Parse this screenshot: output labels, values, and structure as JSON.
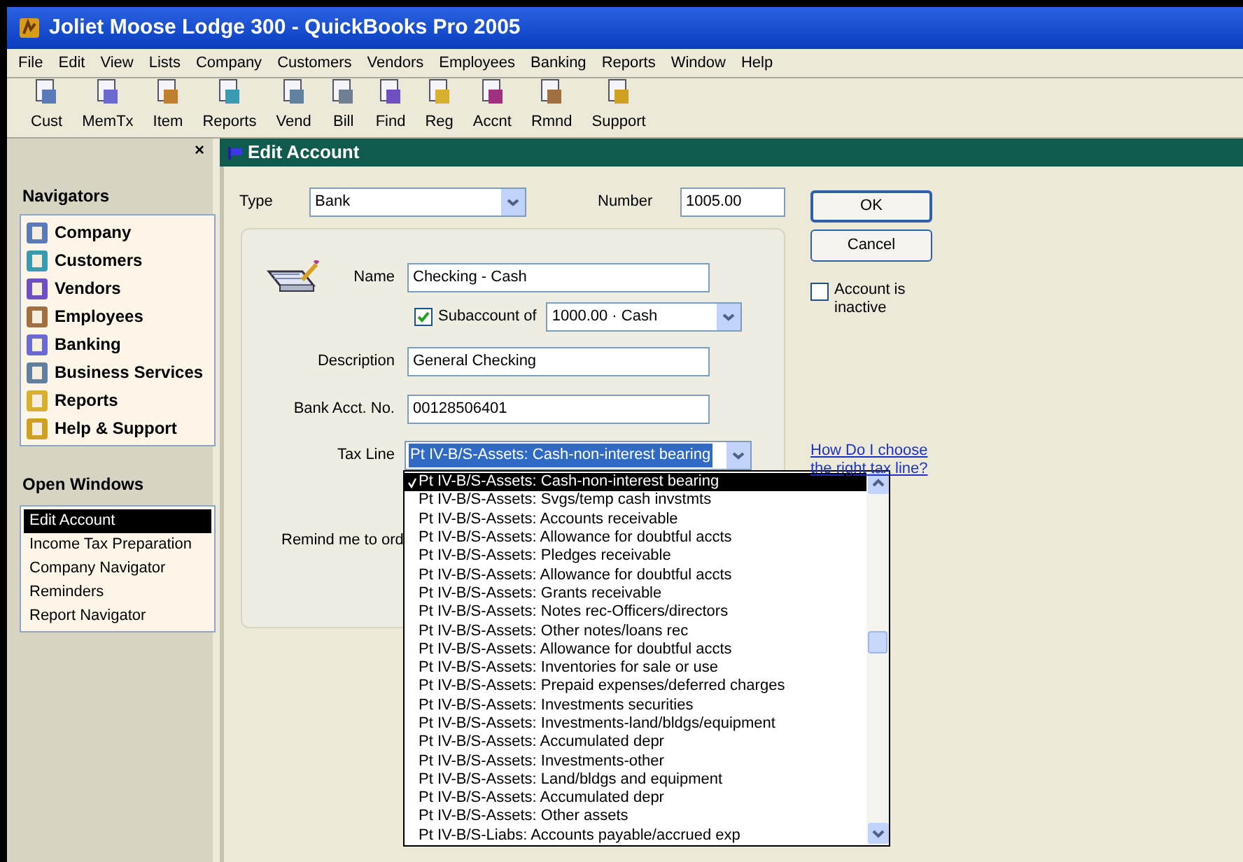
{
  "window": {
    "title": "Joliet Moose Lodge 300 - QuickBooks Pro 2005"
  },
  "menu": [
    "File",
    "Edit",
    "View",
    "Lists",
    "Company",
    "Customers",
    "Vendors",
    "Employees",
    "Banking",
    "Reports",
    "Window",
    "Help"
  ],
  "toolbar": [
    "Cust",
    "MemTx",
    "Item",
    "Reports",
    "Vend",
    "Bill",
    "Find",
    "Reg",
    "Accnt",
    "Rmnd",
    "Support"
  ],
  "sidebar": {
    "close": "×",
    "navigators_title": "Navigators",
    "navigators": [
      "Company",
      "Customers",
      "Vendors",
      "Employees",
      "Banking",
      "Business Services",
      "Reports",
      "Help & Support"
    ],
    "open_windows_title": "Open Windows",
    "open_windows": [
      {
        "label": "Edit Account",
        "selected": true
      },
      {
        "label": "Income Tax Preparation",
        "selected": false
      },
      {
        "label": "Company Navigator",
        "selected": false
      },
      {
        "label": "Reminders",
        "selected": false
      },
      {
        "label": "Report Navigator",
        "selected": false
      }
    ]
  },
  "dialog": {
    "title": "Edit Account",
    "type": {
      "label": "Type",
      "value": "Bank"
    },
    "number": {
      "label": "Number",
      "value": "1005.00"
    },
    "buttons": [
      "OK",
      "Cancel"
    ],
    "inactive": {
      "label": "Account is inactive",
      "checked": false
    },
    "name": {
      "label": "Name",
      "value": "Checking - Cash"
    },
    "subaccount": {
      "label": "Subaccount of",
      "checked": true,
      "value": "1000.00 · Cash"
    },
    "description": {
      "label": "Description",
      "value": "General Checking"
    },
    "bank_acct": {
      "label": "Bank Acct. No.",
      "value": "00128506401"
    },
    "tax_line": {
      "label": "Tax Line",
      "value": "Pt IV-B/S-Assets: Cash-non-interest bearing"
    },
    "help_link": "How Do I choose the right tax line?",
    "remind": "Remind me to ord",
    "tax_line_options": [
      {
        "label": "Pt IV-B/S-Assets: Cash-non-interest bearing",
        "selected": true
      },
      {
        "label": "Pt IV-B/S-Assets: Svgs/temp cash invstmts",
        "selected": false
      },
      {
        "label": "Pt IV-B/S-Assets: Accounts receivable",
        "selected": false
      },
      {
        "label": "Pt IV-B/S-Assets: Allowance for doubtful accts",
        "selected": false
      },
      {
        "label": "Pt IV-B/S-Assets: Pledges receivable",
        "selected": false
      },
      {
        "label": "Pt IV-B/S-Assets: Allowance for doubtful accts",
        "selected": false
      },
      {
        "label": "Pt IV-B/S-Assets: Grants receivable",
        "selected": false
      },
      {
        "label": "Pt IV-B/S-Assets: Notes rec-Officers/directors",
        "selected": false
      },
      {
        "label": "Pt IV-B/S-Assets: Other notes/loans rec",
        "selected": false
      },
      {
        "label": "Pt IV-B/S-Assets: Allowance for doubtful accts",
        "selected": false
      },
      {
        "label": "Pt IV-B/S-Assets: Inventories for sale or use",
        "selected": false
      },
      {
        "label": "Pt IV-B/S-Assets: Prepaid expenses/deferred charges",
        "selected": false
      },
      {
        "label": "Pt IV-B/S-Assets: Investments securities",
        "selected": false
      },
      {
        "label": "Pt IV-B/S-Assets: Investments-land/bldgs/equipment",
        "selected": false
      },
      {
        "label": "Pt IV-B/S-Assets: Accumulated depr",
        "selected": false
      },
      {
        "label": "Pt IV-B/S-Assets: Investments-other",
        "selected": false
      },
      {
        "label": "Pt IV-B/S-Assets: Land/bldgs and equipment",
        "selected": false
      },
      {
        "label": "Pt IV-B/S-Assets: Accumulated depr",
        "selected": false
      },
      {
        "label": "Pt IV-B/S-Assets: Other assets",
        "selected": false
      },
      {
        "label": "Pt IV-B/S-Liabs: Accounts payable/accrued exp",
        "selected": false
      }
    ]
  }
}
